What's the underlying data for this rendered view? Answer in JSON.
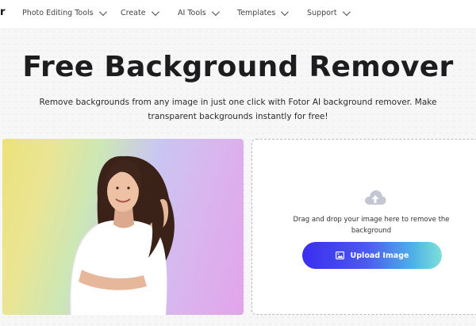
{
  "nav": {
    "logo_fragment": "r",
    "items": [
      {
        "label": "Photo Editing Tools"
      },
      {
        "label": "Create"
      },
      {
        "label": "AI Tools"
      },
      {
        "label": "Templates"
      },
      {
        "label": "Support"
      }
    ]
  },
  "hero": {
    "title": "Free Background Remover",
    "subtitle": "Remove backgrounds from any image in just one click with Fotor AI background remover. Make transparent backgrounds instantly for free!"
  },
  "upload": {
    "instruction": "Drag and drop your image here to remove the background",
    "button_label": "Upload Image",
    "upload_icon": "cloud-upload-icon",
    "button_icon": "image-icon"
  },
  "colors": {
    "button_gradient_start": "#3a2ef0",
    "button_gradient_end": "#7fe0d8",
    "title": "#1d1d1f"
  }
}
